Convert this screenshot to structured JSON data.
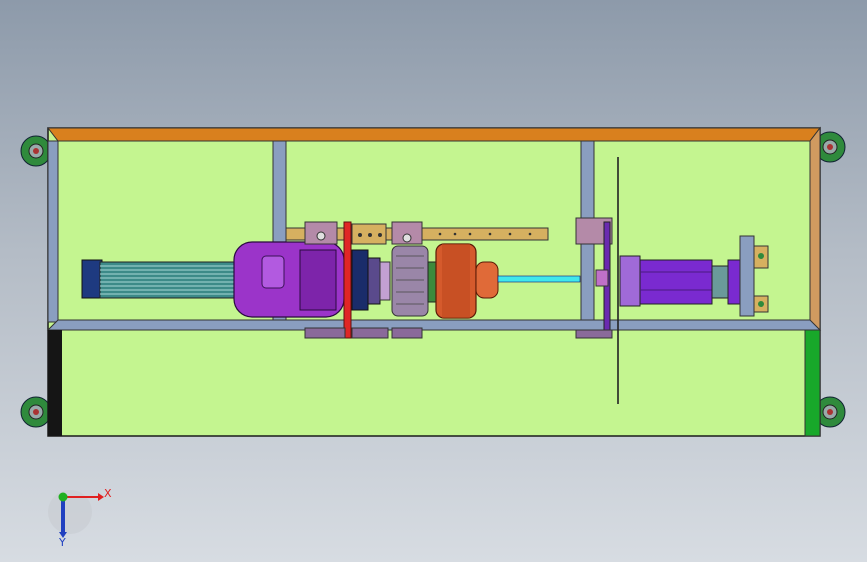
{
  "viewport": {
    "background_top": "#8d9aaa",
    "background_bottom": "#d7dce2"
  },
  "colors": {
    "frame_fill": "#c4f590",
    "frame_outline": "#1a1a1a",
    "beam_blue": "#8a9ec0",
    "top_beam": "#d9801e",
    "motor_purple": "#9b34c9",
    "motor_fins": "#3c8a88",
    "motor_endcap": "#1e3a80",
    "bearing_rail": "#d6b060",
    "red_plate": "#e02626",
    "pulley_orange": "#d55a2c",
    "shaft_cyan": "#3fe8ec",
    "cylinder_purple": "#7a2ad0",
    "bearing_block_pink": "#b48aa8",
    "caster_green": "#2f8a3c",
    "right_strip_tan": "#d09a60",
    "bottom_right_green": "#18a82a"
  },
  "triad": {
    "x_label": "X",
    "y_label": "Y",
    "x_color": "#e02020",
    "y_color": "#2040c0",
    "origin_color": "#20b020"
  },
  "components": [
    "caster-wheel",
    "base-frame",
    "motor",
    "coupling",
    "bearing-housing",
    "pulley",
    "drive-shaft",
    "support-plate",
    "hydraulic-cylinder",
    "end-bracket"
  ]
}
